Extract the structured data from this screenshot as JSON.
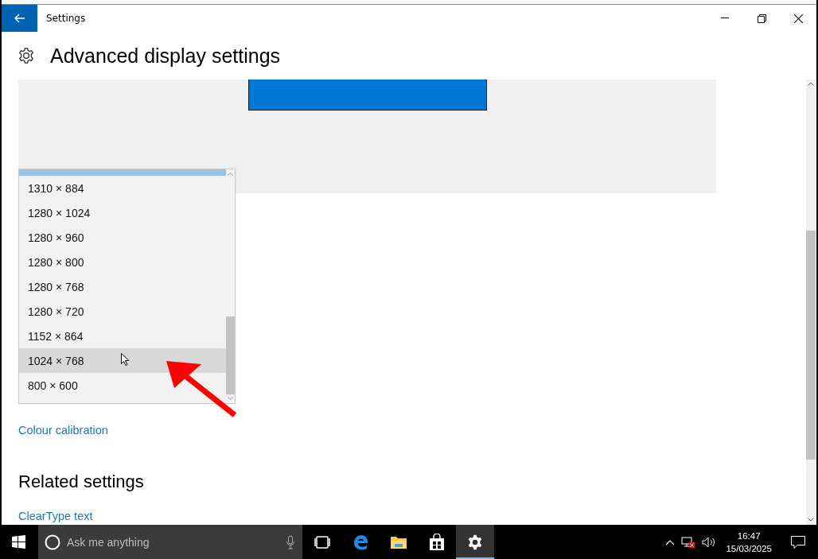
{
  "window": {
    "title": "Settings"
  },
  "page": {
    "title": "Advanced display settings"
  },
  "resolution_list": {
    "items": [
      {
        "label": "1310 × 884",
        "selected": false
      },
      {
        "label": "1280 × 1024",
        "selected": false
      },
      {
        "label": "1280 × 960",
        "selected": false
      },
      {
        "label": "1280 × 800",
        "selected": false
      },
      {
        "label": "1280 × 768",
        "selected": false
      },
      {
        "label": "1280 × 720",
        "selected": false
      },
      {
        "label": "1152 × 864",
        "selected": false
      },
      {
        "label": "1024 × 768",
        "selected": true
      },
      {
        "label": "800 × 600",
        "selected": false
      }
    ]
  },
  "links": [
    "Colour calibration"
  ],
  "related": {
    "heading": "Related settings",
    "links": [
      "ClearType text"
    ]
  },
  "taskbar": {
    "search_placeholder": "Ask me anything",
    "time": "16:47",
    "date": "15/03/2025",
    "apps": [
      {
        "kind": "task-view",
        "selected": false
      },
      {
        "kind": "edge",
        "selected": false
      },
      {
        "kind": "explorer",
        "selected": false
      },
      {
        "kind": "store",
        "selected": false
      },
      {
        "kind": "settings",
        "selected": true
      }
    ]
  }
}
